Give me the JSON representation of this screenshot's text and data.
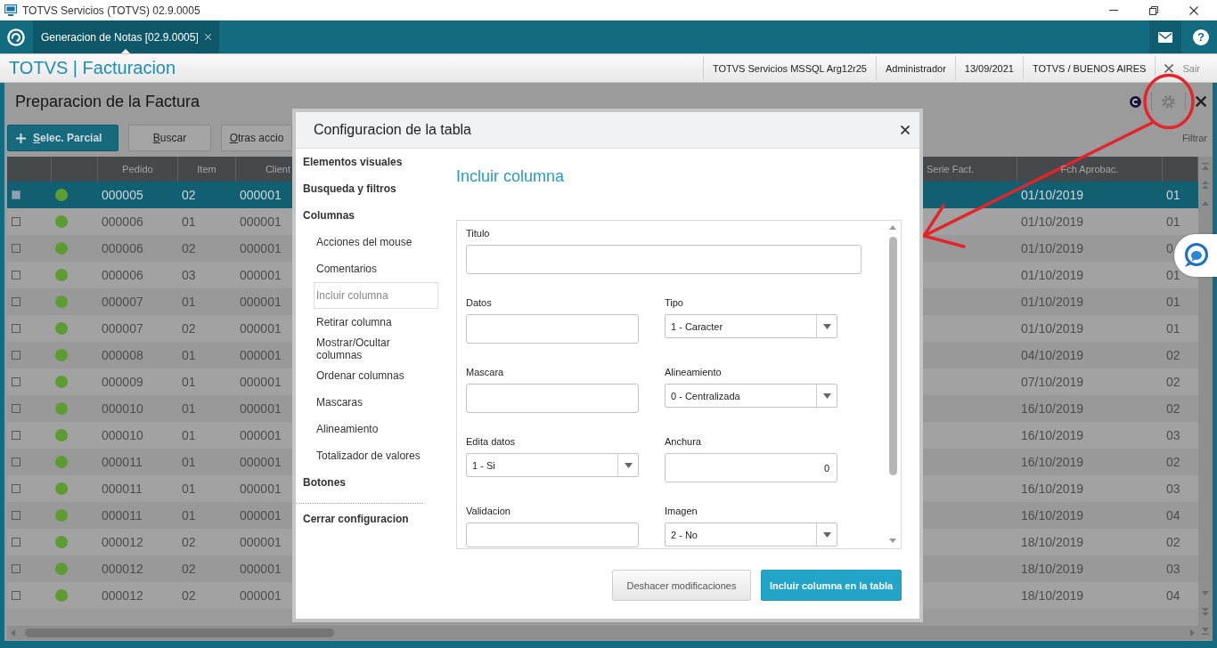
{
  "window": {
    "title": "TOTVS Servicios (TOTVS) 02.9.0005"
  },
  "tabs": [
    {
      "label": "Generacion de Notas [02.9.0005]",
      "selected": true
    }
  ],
  "help_button": {
    "label": "?"
  },
  "app_header": {
    "title": "TOTVS | Facturacion",
    "info": [
      "TOTVS Servicios MSSQL Arg12r25",
      "Administrador",
      "13/09/2021",
      "TOTVS / BUENOS AIRES"
    ],
    "logout": "Sair"
  },
  "page": {
    "title": "Preparacion de la Factura",
    "buttons": [
      {
        "label": "Selec. Parcial",
        "kind": "primary"
      },
      {
        "label": "Buscar",
        "kind": "secondary"
      },
      {
        "label": "Otras accio",
        "kind": "secondary"
      }
    ],
    "filter_link": "Filtrar"
  },
  "table": {
    "columns": [
      "Pedido",
      "Item",
      "Client",
      "Serie Fact.",
      "Fch Aprobac.",
      null
    ],
    "rows": [
      {
        "selected": true,
        "checked": false,
        "color": "#5c9c31",
        "cells": [
          "000005",
          "02",
          "000001",
          null,
          "01/10/2019",
          "01"
        ]
      },
      {
        "selected": false,
        "checked": false,
        "color": "#5c9c31",
        "cells": [
          "000006",
          "01",
          "000001",
          null,
          "01/10/2019",
          "01"
        ]
      },
      {
        "selected": false,
        "checked": false,
        "color": "#5c9c31",
        "cells": [
          "000006",
          "02",
          "000001",
          null,
          "01/10/2019",
          "0"
        ]
      },
      {
        "selected": false,
        "checked": false,
        "color": "#5c9c31",
        "cells": [
          "000006",
          "03",
          "000001",
          null,
          "01/10/2019",
          "01"
        ]
      },
      {
        "selected": false,
        "checked": false,
        "color": "#5c9c31",
        "cells": [
          "000007",
          "01",
          "000001",
          null,
          "01/10/2019",
          "01"
        ]
      },
      {
        "selected": false,
        "checked": false,
        "color": "#5c9c31",
        "cells": [
          "000007",
          "02",
          "000001",
          null,
          "01/10/2019",
          "01"
        ]
      },
      {
        "selected": false,
        "checked": false,
        "color": "#5c9c31",
        "cells": [
          "000008",
          "01",
          "000001",
          null,
          "04/10/2019",
          "02"
        ]
      },
      {
        "selected": false,
        "checked": false,
        "color": "#5c9c31",
        "cells": [
          "000009",
          "01",
          "000001",
          null,
          "07/10/2019",
          "02"
        ]
      },
      {
        "selected": false,
        "checked": false,
        "color": "#5c9c31",
        "cells": [
          "000010",
          "01",
          "000001",
          null,
          "16/10/2019",
          "02"
        ]
      },
      {
        "selected": false,
        "checked": false,
        "color": "#5c9c31",
        "cells": [
          "000010",
          "01",
          "000001",
          null,
          "16/10/2019",
          "03"
        ]
      },
      {
        "selected": false,
        "checked": false,
        "color": "#5c9c31",
        "cells": [
          "000011",
          "01",
          "000001",
          null,
          "16/10/2019",
          "02"
        ]
      },
      {
        "selected": false,
        "checked": false,
        "color": "#5c9c31",
        "cells": [
          "000011",
          "01",
          "000001",
          null,
          "16/10/2019",
          "03"
        ]
      },
      {
        "selected": false,
        "checked": false,
        "color": "#5c9c31",
        "cells": [
          "000011",
          "01",
          "000001",
          null,
          "16/10/2019",
          "04"
        ]
      },
      {
        "selected": false,
        "checked": false,
        "color": "#5c9c31",
        "cells": [
          "000012",
          "02",
          "000001",
          null,
          "18/10/2019",
          "02"
        ]
      },
      {
        "selected": false,
        "checked": false,
        "color": "#5c9c31",
        "cells": [
          "000012",
          "02",
          "000001",
          null,
          "18/10/2019",
          "03"
        ]
      },
      {
        "selected": false,
        "checked": false,
        "color": "#5c9c31",
        "cells": [
          "000012",
          "02",
          "000001",
          null,
          "18/10/2019",
          "04"
        ]
      }
    ]
  },
  "dialog": {
    "title": "Configuracion de la tabla",
    "nav": [
      {
        "label": "Elementos visuales",
        "selected": false
      },
      {
        "label": "Busqueda y filtros",
        "selected": false
      },
      {
        "label": "Columnas",
        "selected": false,
        "children": [
          {
            "label": "Acciones del mouse",
            "selected": false
          },
          {
            "label": "Comentarios",
            "selected": false
          },
          {
            "label": "Incluir columna",
            "selected": true
          },
          {
            "label": "Retirar columna",
            "selected": false
          },
          {
            "label": "Mostrar/Ocultar columnas",
            "selected": false
          },
          {
            "label": "Ordenar columnas",
            "selected": false
          },
          {
            "label": "Mascaras",
            "selected": false
          },
          {
            "label": "Alineamiento",
            "selected": false
          },
          {
            "label": "Totalizador de valores",
            "selected": false
          }
        ]
      },
      {
        "label": "Botones",
        "selected": false
      }
    ],
    "close_link": "Cerrar configuracion",
    "section_title": "Incluir columna",
    "form_rows": [
      {
        "fields": [
          {
            "label": "Titulo",
            "kind": "text"
          }
        ]
      },
      {
        "fields": [
          {
            "label": "Datos",
            "kind": "text"
          },
          {
            "label": "Tipo",
            "kind": "select",
            "value": "1 - Caracter"
          }
        ]
      },
      {
        "fields": [
          {
            "label": "Mascara",
            "kind": "text"
          },
          {
            "label": "Alineamiento",
            "kind": "select",
            "value": "0 - Centralizada"
          }
        ]
      },
      {
        "fields": [
          {
            "label": "Edita datos",
            "kind": "select",
            "value": "1 - Si"
          },
          {
            "label": "Anchura",
            "kind": "number",
            "value": "0"
          }
        ]
      },
      {
        "fields": [
          {
            "label": "Validacion",
            "kind": "text"
          },
          {
            "label": "Imagen",
            "kind": "select",
            "value": "2 - No"
          }
        ]
      }
    ],
    "buttons": [
      {
        "label": "Deshacer modificaciones",
        "kind": "secondary"
      },
      {
        "label": "Incluir columna en la tabla",
        "kind": "primary"
      }
    ]
  }
}
